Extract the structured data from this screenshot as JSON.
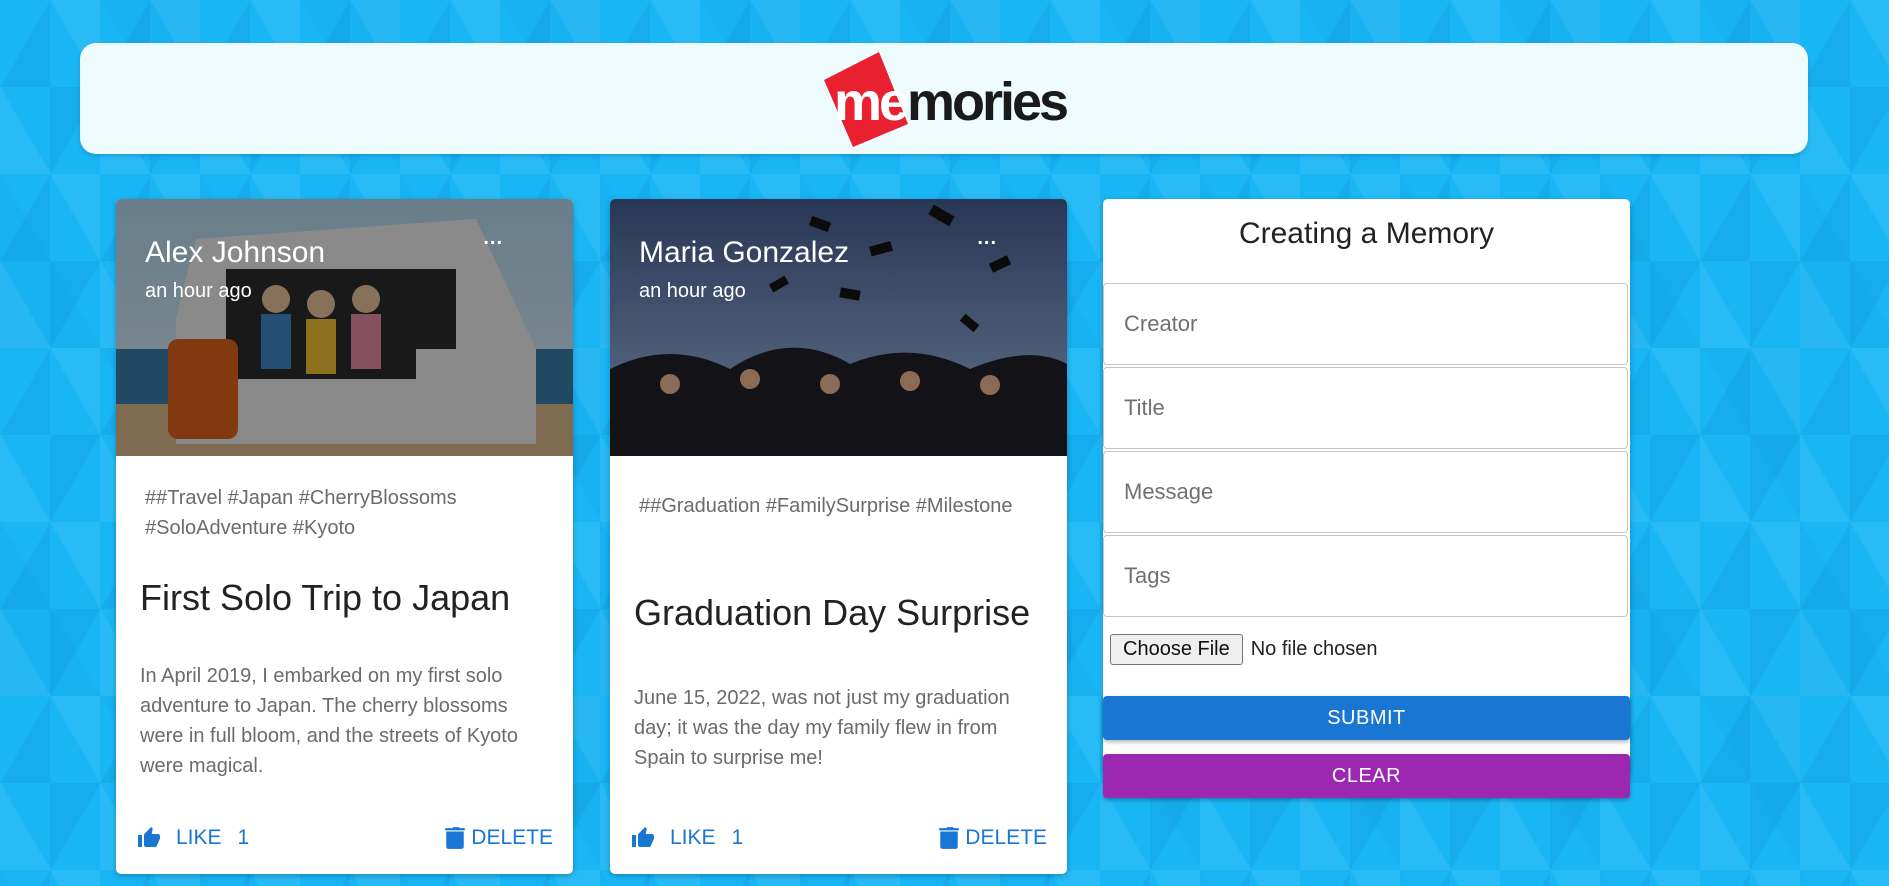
{
  "header": {
    "logo_text": "memories",
    "logo_part1": "me",
    "logo_part2": "mories"
  },
  "posts": [
    {
      "creator": "Alex Johnson",
      "time": "an hour ago",
      "more": "...",
      "tags": "##Travel #Japan #CherryBlossoms #SoloAdventure #Kyoto",
      "title": "First Solo Trip to Japan",
      "message": "In April 2019, I embarked on my first solo adventure to Japan. The cherry blossoms were in full bloom, and the streets of Kyoto were magical.",
      "like_label": "LIKE",
      "like_count": "1",
      "delete_label": "DELETE"
    },
    {
      "creator": "Maria Gonzalez",
      "time": "an hour ago",
      "more": "...",
      "tags": "##Graduation #FamilySurprise #Milestone",
      "title": "Graduation Day Surprise",
      "message": "June 15, 2022, was not just my graduation day; it was the day my family flew in from Spain to surprise me!",
      "like_label": "LIKE",
      "like_count": "1",
      "delete_label": "DELETE"
    }
  ],
  "form": {
    "title": "Creating a Memory",
    "creator_placeholder": "Creator",
    "title_placeholder": "Title",
    "message_placeholder": "Message",
    "tags_placeholder": "Tags",
    "file_button": "Choose File",
    "file_status": "No file chosen",
    "submit_label": "SUBMIT",
    "clear_label": "CLEAR"
  },
  "colors": {
    "background": "#19b6f5",
    "primary": "#1976d2",
    "secondary": "#9c27b0",
    "logo_red": "#e8202f"
  }
}
